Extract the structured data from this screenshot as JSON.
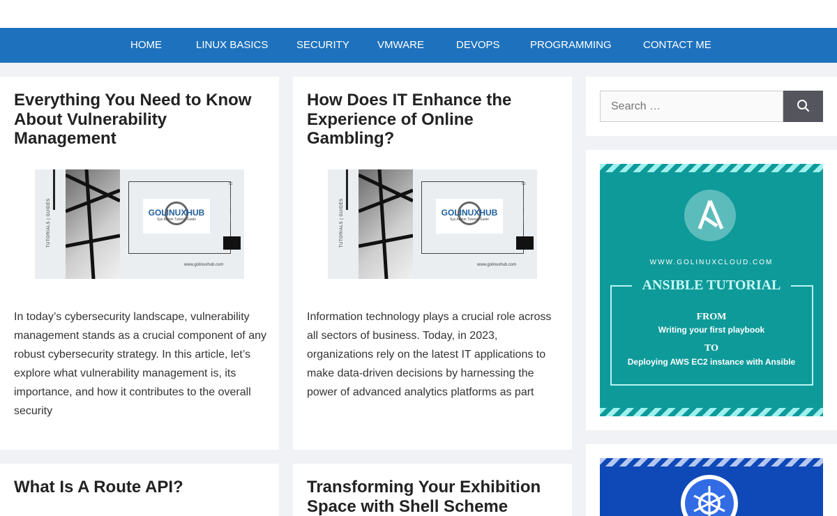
{
  "nav": {
    "items": [
      "HOME",
      "LINUX BASICS",
      "SECURITY",
      "VMWARE",
      "DEVOPS",
      "PROGRAMMING",
      "CONTACT ME"
    ]
  },
  "posts": [
    {
      "title": "Everything You Need to Know About Vulnerability Management",
      "excerpt": "In today’s cybersecurity landscape, vulnerability management stands as a crucial component of any robust cybersecurity strategy. In this article, let’s explore what vulnerability management is, its importance, and how it contributes to the overall security"
    },
    {
      "title": "How Does IT Enhance the Experience of Online Gambling?",
      "excerpt": "Information technology plays a crucial role across all sectors of business. Today, in 2023, organizations rely on the latest IT applications to make data-driven decisions by harnessing the power of advanced analytics platforms as part"
    },
    {
      "title": "What Is A Route API?"
    },
    {
      "title": "Transforming Your Exhibition Space with Shell Scheme"
    }
  ],
  "thumbnail": {
    "side_text": "TUTORIALS | GUIDES",
    "logo": "GOLINUXHUB",
    "logo_sub": "Sys Admin Tutorial Guide",
    "url": "www.golinuxhub.com",
    "number": "01"
  },
  "search": {
    "placeholder": "Search …"
  },
  "ansible_banner": {
    "site": "WWW.GOLINUXCLOUD.COM",
    "heading": "ANSIBLE TUTORIAL",
    "from_label": "FROM",
    "from_text": "Writing your first playbook",
    "to_label": "TO",
    "to_text": "Deploying AWS EC2 instance with Ansible"
  },
  "icons": {
    "search": "search-icon",
    "ansible": "ansible-logo-icon",
    "kubernetes": "kubernetes-logo-icon"
  },
  "colors": {
    "nav": "#1e72bd",
    "banner": "#0f9a9a",
    "k8s": "#0f49b8",
    "search_button": "#55555e"
  }
}
